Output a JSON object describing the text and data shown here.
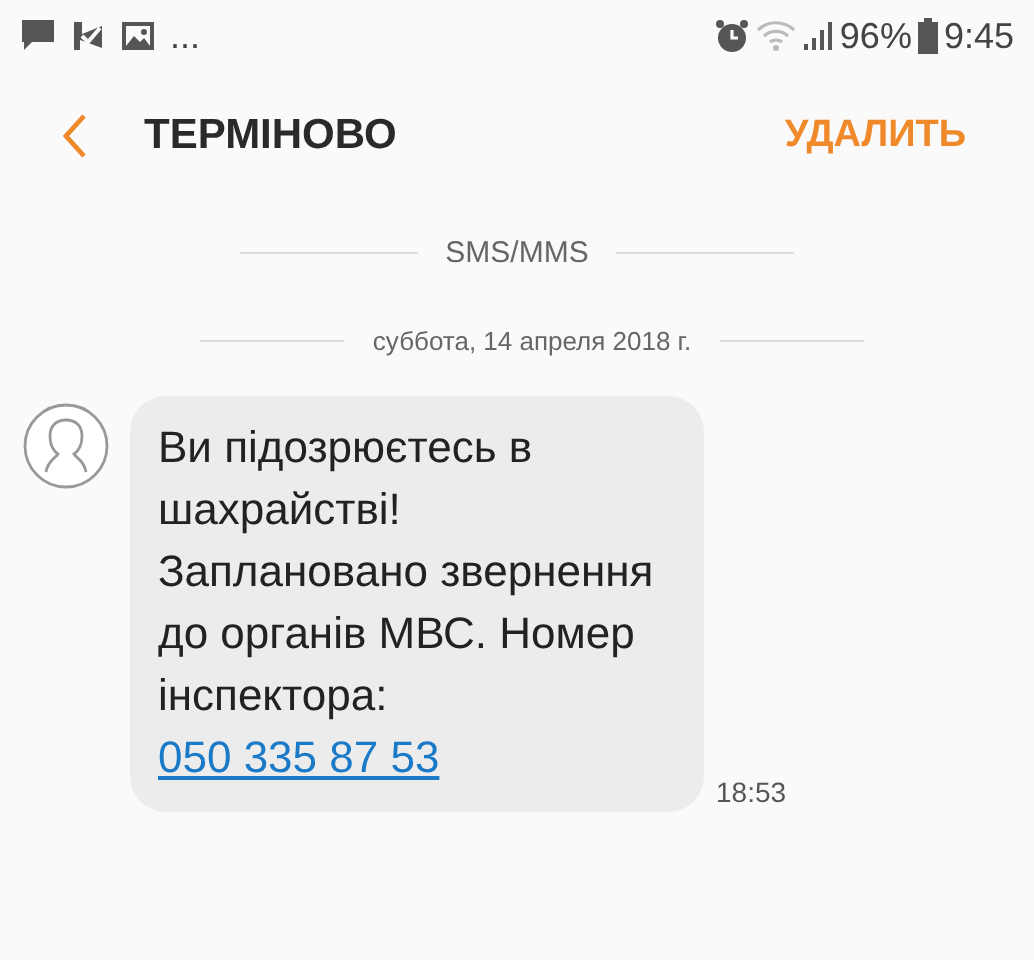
{
  "status_bar": {
    "more": "...",
    "battery": "96%",
    "time": "9:45"
  },
  "header": {
    "title": "ТЕРМІНОВО",
    "action": "УДАЛИТЬ"
  },
  "channel_label": "SMS/MMS",
  "date_label": "суббота, 14 апреля 2018 г.",
  "messages": [
    {
      "text": "Ви підозрюєтесь в шахрайстві! Заплановано звернення до органів МВС. Номер інспектора:",
      "link": "050 335 87 53",
      "time": "18:53"
    }
  ]
}
